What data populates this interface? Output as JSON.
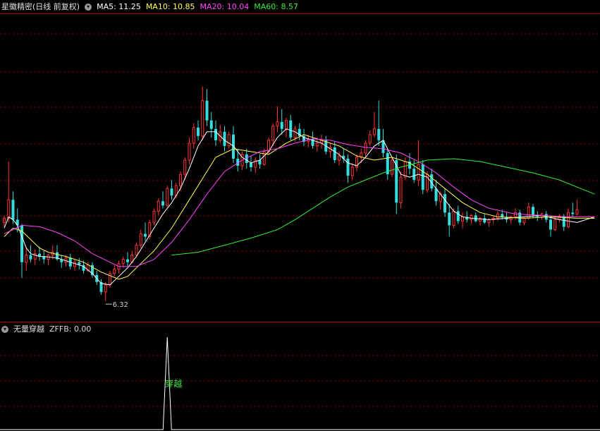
{
  "main_panel": {
    "title": "星徽精密(日线 前复权)",
    "indicators": [
      {
        "label": "MA5: 11.25",
        "color": "#ffffff"
      },
      {
        "label": "MA10: 10.85",
        "color": "#ffff55"
      },
      {
        "label": "MA20: 10.04",
        "color": "#ff44ff"
      },
      {
        "label": "MA60: 8.57",
        "color": "#33ee33"
      }
    ]
  },
  "sub_panel": {
    "title": "无量穿越",
    "indicator": "ZFFB: 0.00",
    "spike_label": "穿越",
    "spike_label_color": "#33ee33"
  },
  "chart_data": {
    "type": "candlestick",
    "up_color": "#ff3333",
    "down_color": "#33dddd",
    "grid_color": "#7a0000",
    "low_marker": {
      "index": 23,
      "value": 6.32,
      "label": "6.32"
    },
    "ohlc": [
      [
        9.1,
        9.35,
        8.95,
        9.25
      ],
      [
        9.25,
        11.25,
        9.1,
        9.9
      ],
      [
        9.9,
        10.2,
        9.05,
        9.2
      ],
      [
        9.2,
        9.6,
        8.75,
        9.0
      ],
      [
        9.0,
        9.05,
        7.15,
        7.7
      ],
      [
        7.7,
        8.2,
        7.4,
        7.95
      ],
      [
        7.95,
        8.3,
        7.7,
        7.8
      ],
      [
        7.8,
        8.15,
        7.6,
        8.0
      ],
      [
        8.0,
        8.25,
        7.75,
        7.9
      ],
      [
        7.9,
        8.1,
        7.65,
        7.8
      ],
      [
        7.8,
        8.0,
        7.6,
        7.95
      ],
      [
        7.95,
        8.3,
        7.8,
        8.05
      ],
      [
        8.05,
        8.3,
        7.75,
        7.8
      ],
      [
        7.8,
        7.95,
        7.5,
        7.7
      ],
      [
        7.7,
        7.95,
        7.55,
        7.85
      ],
      [
        7.85,
        8.0,
        7.45,
        7.55
      ],
      [
        7.55,
        7.8,
        7.4,
        7.7
      ],
      [
        7.7,
        7.85,
        7.45,
        7.6
      ],
      [
        7.6,
        7.75,
        7.3,
        7.4
      ],
      [
        7.4,
        7.7,
        7.35,
        7.6
      ],
      [
        7.6,
        7.7,
        7.15,
        7.25
      ],
      [
        7.25,
        7.4,
        6.9,
        7.0
      ],
      [
        7.0,
        7.1,
        6.55,
        6.65
      ],
      [
        6.65,
        7.0,
        6.32,
        6.9
      ],
      [
        6.9,
        7.4,
        6.8,
        7.3
      ],
      [
        7.3,
        7.6,
        7.2,
        7.45
      ],
      [
        7.45,
        7.75,
        7.3,
        7.65
      ],
      [
        7.65,
        7.9,
        7.5,
        7.8
      ],
      [
        7.8,
        8.05,
        7.55,
        7.7
      ],
      [
        7.7,
        8.1,
        7.65,
        7.95
      ],
      [
        7.95,
        8.4,
        7.9,
        8.3
      ],
      [
        8.3,
        8.85,
        8.2,
        8.7
      ],
      [
        8.7,
        9.1,
        8.45,
        8.6
      ],
      [
        8.6,
        9.2,
        8.5,
        9.1
      ],
      [
        9.1,
        9.6,
        9.0,
        9.5
      ],
      [
        9.5,
        9.95,
        9.35,
        9.85
      ],
      [
        9.85,
        10.2,
        9.6,
        9.7
      ],
      [
        9.7,
        10.4,
        9.65,
        10.3
      ],
      [
        10.3,
        10.6,
        9.9,
        10.05
      ],
      [
        10.05,
        10.5,
        9.95,
        10.4
      ],
      [
        10.4,
        10.9,
        10.2,
        10.8
      ],
      [
        10.8,
        11.4,
        10.6,
        11.3
      ],
      [
        11.3,
        12.1,
        11.15,
        11.9
      ],
      [
        11.9,
        12.6,
        11.7,
        12.45
      ],
      [
        12.45,
        12.7,
        12.0,
        12.15
      ],
      [
        12.15,
        13.9,
        12.0,
        13.4
      ],
      [
        13.4,
        13.8,
        12.5,
        12.7
      ],
      [
        12.7,
        13.0,
        12.1,
        12.4
      ],
      [
        12.4,
        12.7,
        11.8,
        12.0
      ],
      [
        12.0,
        12.55,
        11.9,
        12.3
      ],
      [
        12.3,
        12.5,
        11.6,
        11.8
      ],
      [
        11.8,
        12.3,
        11.7,
        12.2
      ],
      [
        12.2,
        12.5,
        11.2,
        11.35
      ],
      [
        11.35,
        11.7,
        10.9,
        11.1
      ],
      [
        11.1,
        11.6,
        10.95,
        11.5
      ],
      [
        11.5,
        11.7,
        11.0,
        11.2
      ],
      [
        11.2,
        11.45,
        10.9,
        11.05
      ],
      [
        11.05,
        11.4,
        10.85,
        11.3
      ],
      [
        11.3,
        11.5,
        11.0,
        11.15
      ],
      [
        11.15,
        11.7,
        11.1,
        11.6
      ],
      [
        11.6,
        12.1,
        11.5,
        12.0
      ],
      [
        12.0,
        12.6,
        11.8,
        12.5
      ],
      [
        12.5,
        13.2,
        12.3,
        12.65
      ],
      [
        12.65,
        13.1,
        12.2,
        12.4
      ],
      [
        12.4,
        12.8,
        12.1,
        12.7
      ],
      [
        12.7,
        12.9,
        12.0,
        12.1
      ],
      [
        12.1,
        12.5,
        11.95,
        12.4
      ],
      [
        12.4,
        12.6,
        12.0,
        12.15
      ],
      [
        12.15,
        12.4,
        11.8,
        11.95
      ],
      [
        11.95,
        12.2,
        11.75,
        12.05
      ],
      [
        12.05,
        12.3,
        11.7,
        11.8
      ],
      [
        11.8,
        12.1,
        11.6,
        11.9
      ],
      [
        11.9,
        12.2,
        11.7,
        12.0
      ],
      [
        12.0,
        12.15,
        11.5,
        11.6
      ],
      [
        11.6,
        11.9,
        11.4,
        11.75
      ],
      [
        11.75,
        11.95,
        11.2,
        11.3
      ],
      [
        11.3,
        11.6,
        11.1,
        11.45
      ],
      [
        11.45,
        11.7,
        11.2,
        11.35
      ],
      [
        11.35,
        11.5,
        10.5,
        10.75
      ],
      [
        10.75,
        11.2,
        10.6,
        11.05
      ],
      [
        11.05,
        11.5,
        10.9,
        11.4
      ],
      [
        11.4,
        11.7,
        11.2,
        11.55
      ],
      [
        11.55,
        12.0,
        11.4,
        11.9
      ],
      [
        11.9,
        12.35,
        11.8,
        12.2
      ],
      [
        12.2,
        13.0,
        12.1,
        12.4
      ],
      [
        12.4,
        13.4,
        11.8,
        12.0
      ],
      [
        12.0,
        12.4,
        11.4,
        11.55
      ],
      [
        11.55,
        11.7,
        10.6,
        10.8
      ],
      [
        10.8,
        11.4,
        10.7,
        11.3
      ],
      [
        11.3,
        11.5,
        9.4,
        9.8
      ],
      [
        9.8,
        10.9,
        9.6,
        10.7
      ],
      [
        10.7,
        11.4,
        10.6,
        11.25
      ],
      [
        11.25,
        11.55,
        10.8,
        11.0
      ],
      [
        11.0,
        11.3,
        10.5,
        10.6
      ],
      [
        10.6,
        12.0,
        10.4,
        11.15
      ],
      [
        11.15,
        11.3,
        10.1,
        10.25
      ],
      [
        10.25,
        10.9,
        10.15,
        10.8
      ],
      [
        10.8,
        11.0,
        10.2,
        10.3
      ],
      [
        10.3,
        10.6,
        9.7,
        9.85
      ],
      [
        9.85,
        10.2,
        9.55,
        10.1
      ],
      [
        10.1,
        10.3,
        9.3,
        9.45
      ],
      [
        9.45,
        9.75,
        8.6,
        9.0
      ],
      [
        9.0,
        9.6,
        8.9,
        9.5
      ],
      [
        9.5,
        9.7,
        9.05,
        9.15
      ],
      [
        9.15,
        9.45,
        8.9,
        9.3
      ],
      [
        9.3,
        9.5,
        9.1,
        9.2
      ],
      [
        9.2,
        9.4,
        9.05,
        9.35
      ],
      [
        9.35,
        9.45,
        9.1,
        9.15
      ],
      [
        9.15,
        9.3,
        9.0,
        9.25
      ],
      [
        9.25,
        9.4,
        9.05,
        9.1
      ],
      [
        9.1,
        9.25,
        8.95,
        9.2
      ],
      [
        9.2,
        9.35,
        9.05,
        9.25
      ],
      [
        9.25,
        9.5,
        9.15,
        9.4
      ],
      [
        9.4,
        9.55,
        9.2,
        9.3
      ],
      [
        9.3,
        9.45,
        9.1,
        9.2
      ],
      [
        9.2,
        9.35,
        9.05,
        9.3
      ],
      [
        9.3,
        9.6,
        9.2,
        9.45
      ],
      [
        9.45,
        9.55,
        9.0,
        9.1
      ],
      [
        9.1,
        9.3,
        9.0,
        9.25
      ],
      [
        9.25,
        9.8,
        9.2,
        9.65
      ],
      [
        9.65,
        9.75,
        9.25,
        9.35
      ],
      [
        9.35,
        9.5,
        9.15,
        9.3
      ],
      [
        9.3,
        9.45,
        9.2,
        9.4
      ],
      [
        9.4,
        9.5,
        9.1,
        9.2
      ],
      [
        9.2,
        9.35,
        8.6,
        8.85
      ],
      [
        8.85,
        9.3,
        8.8,
        9.2
      ],
      [
        9.2,
        9.4,
        9.1,
        9.3
      ],
      [
        9.3,
        9.4,
        8.8,
        8.95
      ],
      [
        8.95,
        9.6,
        8.9,
        9.45
      ],
      [
        9.45,
        9.8,
        9.3,
        9.4
      ],
      [
        9.4,
        9.9,
        9.35,
        9.55
      ]
    ],
    "ma5": [
      [
        0,
        8.9
      ],
      [
        1,
        9.3
      ],
      [
        2,
        9.2
      ],
      [
        3,
        9.0
      ],
      [
        4,
        8.6
      ],
      [
        5,
        8.2
      ],
      [
        6,
        8.0
      ],
      [
        7,
        7.95
      ],
      [
        8,
        7.9
      ],
      [
        9,
        7.9
      ],
      [
        12,
        7.85
      ],
      [
        15,
        7.7
      ],
      [
        18,
        7.55
      ],
      [
        20,
        7.3
      ],
      [
        22,
        6.95
      ],
      [
        24,
        6.9
      ],
      [
        26,
        7.2
      ],
      [
        28,
        7.5
      ],
      [
        30,
        7.9
      ],
      [
        32,
        8.4
      ],
      [
        34,
        8.9
      ],
      [
        36,
        9.4
      ],
      [
        38,
        9.8
      ],
      [
        40,
        10.3
      ],
      [
        42,
        11.0
      ],
      [
        44,
        11.8
      ],
      [
        46,
        12.3
      ],
      [
        48,
        12.3
      ],
      [
        50,
        12.0
      ],
      [
        52,
        11.8
      ],
      [
        54,
        11.4
      ],
      [
        56,
        11.2
      ],
      [
        58,
        11.3
      ],
      [
        60,
        11.6
      ],
      [
        62,
        12.1
      ],
      [
        64,
        12.4
      ],
      [
        66,
        12.3
      ],
      [
        68,
        12.1
      ],
      [
        70,
        12.0
      ],
      [
        72,
        11.9
      ],
      [
        74,
        11.7
      ],
      [
        76,
        11.5
      ],
      [
        78,
        11.2
      ],
      [
        80,
        11.1
      ],
      [
        82,
        11.4
      ],
      [
        84,
        11.8
      ],
      [
        86,
        12.0
      ],
      [
        88,
        11.4
      ],
      [
        90,
        10.8
      ],
      [
        92,
        10.7
      ],
      [
        94,
        10.8
      ],
      [
        96,
        10.7
      ],
      [
        98,
        10.3
      ],
      [
        100,
        9.9
      ],
      [
        102,
        9.5
      ],
      [
        104,
        9.3
      ],
      [
        106,
        9.25
      ],
      [
        110,
        9.2
      ],
      [
        114,
        9.25
      ],
      [
        118,
        9.3
      ],
      [
        122,
        9.35
      ],
      [
        126,
        9.2
      ],
      [
        130,
        9.1
      ],
      [
        134,
        9.3
      ]
    ],
    "ma10": [
      [
        0,
        8.6
      ],
      [
        2,
        8.9
      ],
      [
        4,
        8.8
      ],
      [
        6,
        8.5
      ],
      [
        8,
        8.2
      ],
      [
        10,
        8.05
      ],
      [
        14,
        7.9
      ],
      [
        18,
        7.7
      ],
      [
        22,
        7.35
      ],
      [
        26,
        7.1
      ],
      [
        28,
        7.2
      ],
      [
        30,
        7.5
      ],
      [
        34,
        8.1
      ],
      [
        38,
        8.9
      ],
      [
        42,
        9.9
      ],
      [
        46,
        10.9
      ],
      [
        48,
        11.4
      ],
      [
        52,
        11.7
      ],
      [
        56,
        11.6
      ],
      [
        60,
        11.5
      ],
      [
        64,
        11.9
      ],
      [
        68,
        12.2
      ],
      [
        72,
        12.0
      ],
      [
        76,
        11.8
      ],
      [
        80,
        11.45
      ],
      [
        84,
        11.3
      ],
      [
        88,
        11.4
      ],
      [
        92,
        11.2
      ],
      [
        96,
        10.8
      ],
      [
        100,
        10.3
      ],
      [
        104,
        9.8
      ],
      [
        108,
        9.45
      ],
      [
        112,
        9.3
      ],
      [
        118,
        9.25
      ],
      [
        124,
        9.3
      ],
      [
        130,
        9.25
      ],
      [
        134,
        9.25
      ]
    ],
    "ma20": [
      [
        0,
        8.7
      ],
      [
        4,
        9.0
      ],
      [
        8,
        8.95
      ],
      [
        12,
        8.75
      ],
      [
        16,
        8.45
      ],
      [
        20,
        8.0
      ],
      [
        24,
        7.7
      ],
      [
        26,
        7.55
      ],
      [
        30,
        7.55
      ],
      [
        34,
        7.8
      ],
      [
        38,
        8.4
      ],
      [
        42,
        9.2
      ],
      [
        46,
        10.1
      ],
      [
        50,
        10.9
      ],
      [
        54,
        11.3
      ],
      [
        58,
        11.6
      ],
      [
        62,
        11.7
      ],
      [
        66,
        11.9
      ],
      [
        70,
        12.05
      ],
      [
        74,
        12.0
      ],
      [
        78,
        11.85
      ],
      [
        82,
        11.75
      ],
      [
        86,
        11.7
      ],
      [
        90,
        11.55
      ],
      [
        94,
        11.25
      ],
      [
        98,
        10.85
      ],
      [
        102,
        10.35
      ],
      [
        106,
        9.9
      ],
      [
        110,
        9.6
      ],
      [
        116,
        9.4
      ],
      [
        122,
        9.35
      ],
      [
        128,
        9.3
      ],
      [
        134,
        9.3
      ]
    ],
    "ma60": [
      [
        38,
        7.95
      ],
      [
        44,
        8.05
      ],
      [
        50,
        8.3
      ],
      [
        56,
        8.55
      ],
      [
        62,
        8.85
      ],
      [
        66,
        9.2
      ],
      [
        70,
        9.6
      ],
      [
        74,
        10.0
      ],
      [
        78,
        10.35
      ],
      [
        82,
        10.6
      ],
      [
        86,
        10.85
      ],
      [
        90,
        11.05
      ],
      [
        96,
        11.3
      ],
      [
        102,
        11.35
      ],
      [
        108,
        11.25
      ],
      [
        114,
        11.05
      ],
      [
        120,
        10.85
      ],
      [
        126,
        10.6
      ],
      [
        130,
        10.35
      ],
      [
        134,
        10.1
      ]
    ],
    "zffb": {
      "spike_index": 37,
      "spike_value": 1.0,
      "baseline": 0.0
    }
  }
}
